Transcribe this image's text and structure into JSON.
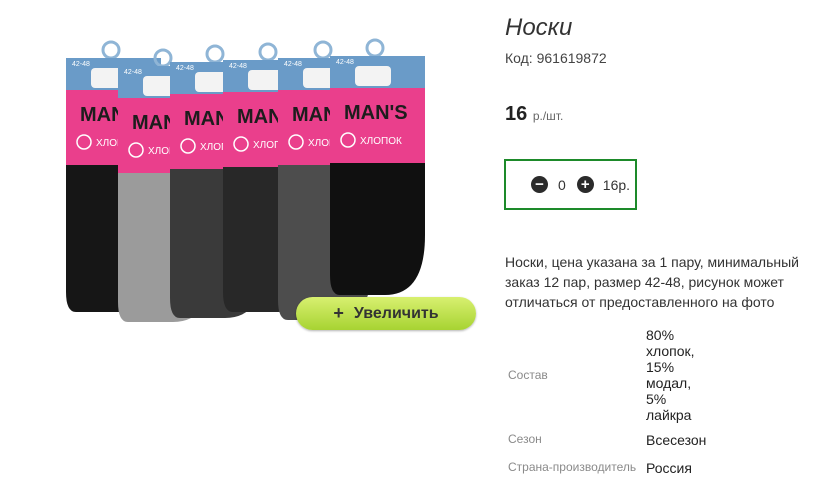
{
  "product": {
    "title": "Носки",
    "code": "Код: 961619872",
    "price": "16",
    "price_unit": "р./шт.",
    "description": "Носки, цена указана за 1 пару, минимальный заказ 12 пар, размер 42-48, рисунок может отличаться от предоставленного на фото"
  },
  "image": {
    "zoom_label": "Увеличить",
    "zoom_icon": "plus-icon",
    "sock_colors": [
      "#161616",
      "#9b9b9b",
      "#3a3a3a",
      "#282828",
      "#4d4d4d",
      "#101010"
    ],
    "tag_color": "#ea3f8c",
    "tag_brand": "MAN'S",
    "tag_cotton": "ХЛОПОК",
    "tag_size": "42-48"
  },
  "quantity": {
    "value": "0",
    "sum": "16р.",
    "minus_icon": "minus-circle-icon",
    "plus_icon": "plus-circle-icon",
    "border_color": "#1d8a2a"
  },
  "specs": {
    "composition_label": "Состав",
    "composition_lines": [
      "80%",
      "хлопок,",
      "15%",
      "модал,",
      "5%",
      "лайкра"
    ],
    "season_label": "Сезон",
    "season_value": "Всесезон",
    "country_label": "Страна-производитель",
    "country_value": "Россия"
  }
}
